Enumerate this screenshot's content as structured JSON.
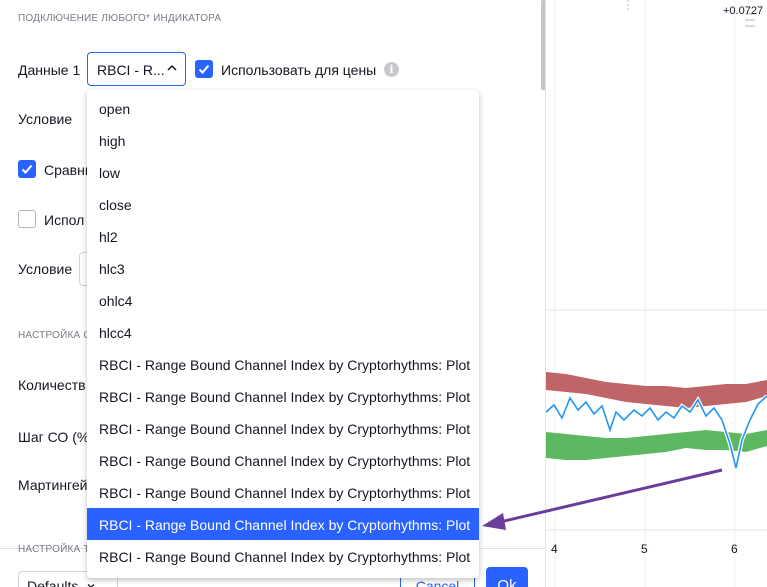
{
  "section_title": "ПОДКЛЮЧЕНИЕ ЛЮБОГО* ИНДИКАТОРА",
  "data1": {
    "label": "Данные 1",
    "select_value": "RBCI - R...",
    "use_for_price_label": "Использовать для цены",
    "use_for_price_checked": true
  },
  "condition1_label": "Условие",
  "compare_label": "Сравни",
  "compare_checked": true,
  "use_label": "Испол",
  "use_checked": false,
  "condition2_label": "Условие",
  "section2_title": "НАСТРОЙКА С",
  "quantity_label": "Количеств",
  "step_label": "Шаг СО (%)",
  "martingale_label": "Мартингей",
  "section3_title": "НАСТРОЙКА Т",
  "footer": {
    "defaults_label": "Defaults",
    "cancel_label": "Cancel",
    "ok_label": "Ok"
  },
  "chart": {
    "top_value": "+0.0727",
    "x_ticks": [
      "4",
      "5",
      "6"
    ],
    "colors": {
      "upper_band": "#b85456",
      "lower_band": "#4caf50",
      "line": "#2196f3"
    }
  },
  "dropdown": {
    "options": [
      "open",
      "high",
      "low",
      "close",
      "hl2",
      "hlc3",
      "ohlc4",
      "hlcc4",
      "RBCI - Range Bound Channel Index by Cryptorhythms: Plot",
      "RBCI - Range Bound Channel Index by Cryptorhythms: Plot",
      "RBCI - Range Bound Channel Index by Cryptorhythms: Plot",
      "RBCI - Range Bound Channel Index by Cryptorhythms: Plot",
      "RBCI - Range Bound Channel Index by Cryptorhythms: Plot",
      "RBCI - Range Bound Channel Index by Cryptorhythms: Plot",
      "RBCI - Range Bound Channel Index by Cryptorhythms: Plot"
    ],
    "selected_index": 13
  },
  "accent_color": "#2962ff",
  "annotation_arrow_color": "#6a3d9a"
}
